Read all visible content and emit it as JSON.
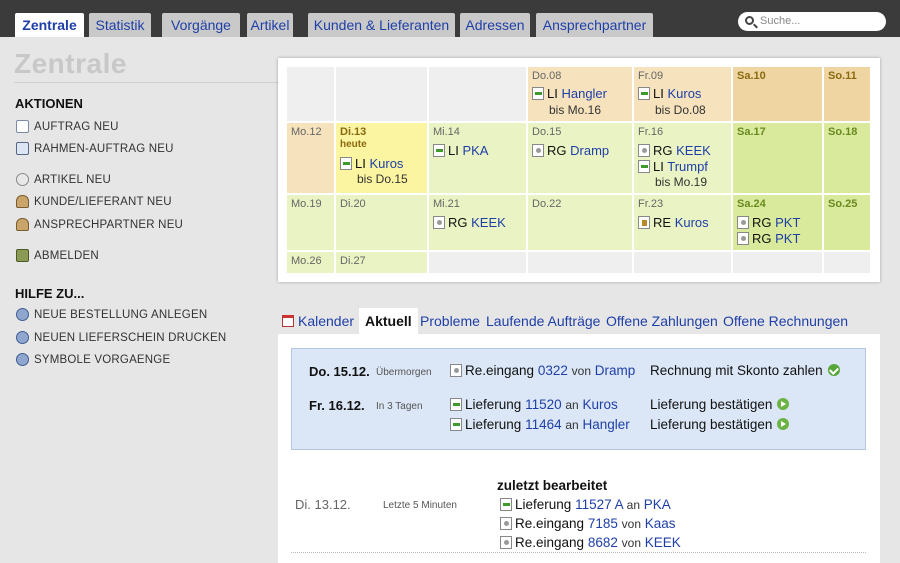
{
  "nav": {
    "tabs": [
      {
        "label": "Zentrale"
      },
      {
        "label": "Statistik"
      },
      {
        "label": "Vorgänge"
      },
      {
        "label": "Artikel"
      },
      {
        "label": "Kunden & Lieferanten"
      },
      {
        "label": "Adressen"
      },
      {
        "label": "Ansprechpartner"
      }
    ],
    "search_placeholder": "Suche..."
  },
  "sidebar": {
    "title": "Zentrale",
    "actions_heading": "AKTIONEN",
    "actions": [
      {
        "label": "AUFTRAG NEU",
        "icon": "document-icon"
      },
      {
        "label": "RAHMEN-AUFTRAG NEU",
        "icon": "frame-order-icon"
      },
      {
        "label": "ARTIKEL NEU",
        "icon": "article-icon"
      },
      {
        "label": "KUNDE/LIEFERANT NEU",
        "icon": "customer-icon"
      },
      {
        "label": "ANSPRECHPARTNER NEU",
        "icon": "contact-person-icon"
      },
      {
        "label": "ABMELDEN",
        "icon": "logout-icon"
      }
    ],
    "help_heading": "HILFE ZU...",
    "help": [
      {
        "label": "NEUE BESTELLUNG ANLEGEN"
      },
      {
        "label": "NEUEN LIEFERSCHEIN DRUCKEN"
      },
      {
        "label": "SYMBOLE VORGAENGE"
      }
    ]
  },
  "calendar": {
    "colors": {
      "empty": "#efefef",
      "past_weekday": "#f6e3bd",
      "past_weekend": "#efd5a2",
      "today": "#fbf4a0",
      "future_weekday": "#eaf3c4",
      "future_weekend": "#d9ea9c"
    },
    "row1": {
      "do08": {
        "date": "Do.08",
        "ev_code": "LI",
        "ev_name": "Hangler",
        "sub": "bis Mo.16"
      },
      "fr09": {
        "date": "Fr.09",
        "ev_code": "LI",
        "ev_name": "Kuros",
        "sub": "bis Do.08"
      },
      "sa10": {
        "date": "Sa.10"
      },
      "so11": {
        "date": "So.11"
      }
    },
    "row2": {
      "mo12": {
        "date": "Mo.12"
      },
      "di13": {
        "date": "Di.13",
        "today_label": "heute",
        "ev_code": "LI",
        "ev_name": "Kuros",
        "sub": "bis Do.15"
      },
      "mi14": {
        "date": "Mi.14",
        "ev_code": "LI",
        "ev_name": "PKA"
      },
      "do15": {
        "date": "Do.15",
        "ev_code": "RG",
        "ev_name": "Dramp"
      },
      "fr16": {
        "date": "Fr.16",
        "ev1_code": "RG",
        "ev1_name": "KEEK",
        "ev2_code": "LI",
        "ev2_name": "Trumpf",
        "sub": "bis Mo.19"
      },
      "sa17": {
        "date": "Sa.17"
      },
      "so18": {
        "date": "So.18"
      }
    },
    "row3": {
      "mo19": {
        "date": "Mo.19"
      },
      "di20": {
        "date": "Di.20"
      },
      "mi21": {
        "date": "Mi.21",
        "ev_code": "RG",
        "ev_name": "KEEK"
      },
      "do22": {
        "date": "Do.22"
      },
      "fr23": {
        "date": "Fr.23",
        "ev_code": "RE",
        "ev_name": "Kuros"
      },
      "sa24": {
        "date": "Sa.24",
        "ev1_code": "RG",
        "ev1_name": "PKT",
        "ev2_code": "RG",
        "ev2_name": "PKT"
      },
      "so25": {
        "date": "So.25"
      }
    },
    "row4": {
      "mo26": {
        "date": "Mo.26"
      },
      "di27": {
        "date": "Di.27"
      }
    }
  },
  "subtabs": [
    {
      "label": "Kalender"
    },
    {
      "label": "Aktuell"
    },
    {
      "label": "Probleme"
    },
    {
      "label": "Laufende Aufträge"
    },
    {
      "label": "Offene Zahlungen"
    },
    {
      "label": "Offene Rechnungen"
    }
  ],
  "aktuell": {
    "r1": {
      "date": "Do. 15.12.",
      "rel": "Übermorgen",
      "type": "Re.eingang",
      "num": "0322",
      "prep": "von",
      "party": "Dramp",
      "task": "Rechnung mit Skonto zahlen"
    },
    "r2": {
      "date": "Fr. 16.12.",
      "rel": "In 3 Tagen",
      "type": "Lieferung",
      "num": "11520",
      "prep": "an",
      "party": "Kuros",
      "task": "Lieferung bestätigen"
    },
    "r3": {
      "type": "Lieferung",
      "num": "11464",
      "prep": "an",
      "party": "Hangler",
      "task": "Lieferung bestätigen"
    },
    "recent_heading": "zuletzt bearbeitet",
    "recent_date": "Di. 13.12.",
    "recent_rel": "Letzte 5 Minuten",
    "recent": [
      {
        "type": "Lieferung",
        "num": "11527 A",
        "prep": "an",
        "party": "PKA"
      },
      {
        "type": "Re.eingang",
        "num": "7185",
        "prep": "von",
        "party": "Kaas"
      },
      {
        "type": "Re.eingang",
        "num": "8682",
        "prep": "von",
        "party": "KEEK"
      }
    ]
  }
}
